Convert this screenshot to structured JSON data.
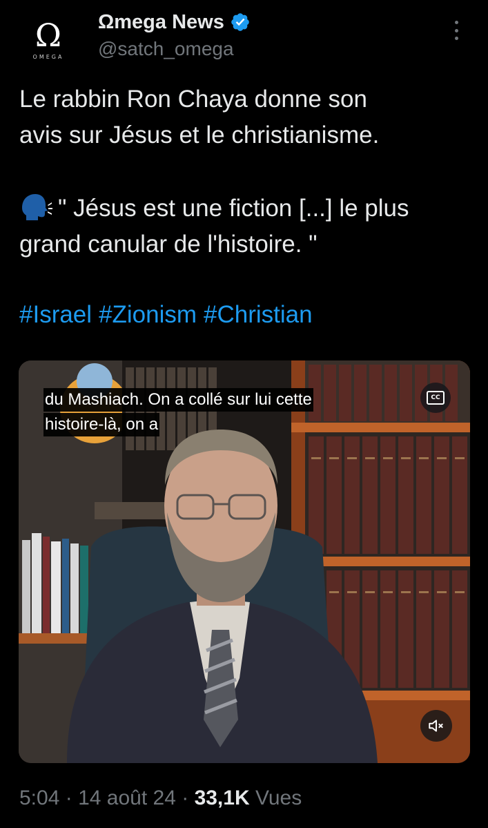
{
  "author": {
    "avatar_symbol": "Ω",
    "avatar_wordmark": "OMEGA",
    "display_name": "Ωmega News",
    "handle": "@satch_omega",
    "verified": true,
    "verified_color": "#1d9bf0"
  },
  "post": {
    "lines": [
      "Le rabbin Ron Chaya donne son",
      "avis sur Jésus et le christianisme.",
      "\" Jésus est une fiction [...] le plus",
      "grand canular de l'histoire. \""
    ],
    "quote_icon": "speaking-head-icon",
    "hashtags": [
      "#Israel",
      "#Zionism",
      "#Christian"
    ],
    "hashtag_color": "#1d9bf0"
  },
  "video": {
    "caption_lines": [
      "du Mashiach. On a collé sur lui cette",
      "histoire-là, on a"
    ],
    "cc_label": "CC",
    "cc_icon": "closed-captions-icon",
    "mute_icon": "muted-speaker-icon"
  },
  "meta": {
    "time": "5:04",
    "separator": "·",
    "date": "14 août 24",
    "views_count": "33,1K",
    "views_label": "Vues"
  },
  "colors": {
    "background": "#000000",
    "text": "#e7e9ea",
    "secondary": "#71767b",
    "accent": "#1d9bf0"
  }
}
